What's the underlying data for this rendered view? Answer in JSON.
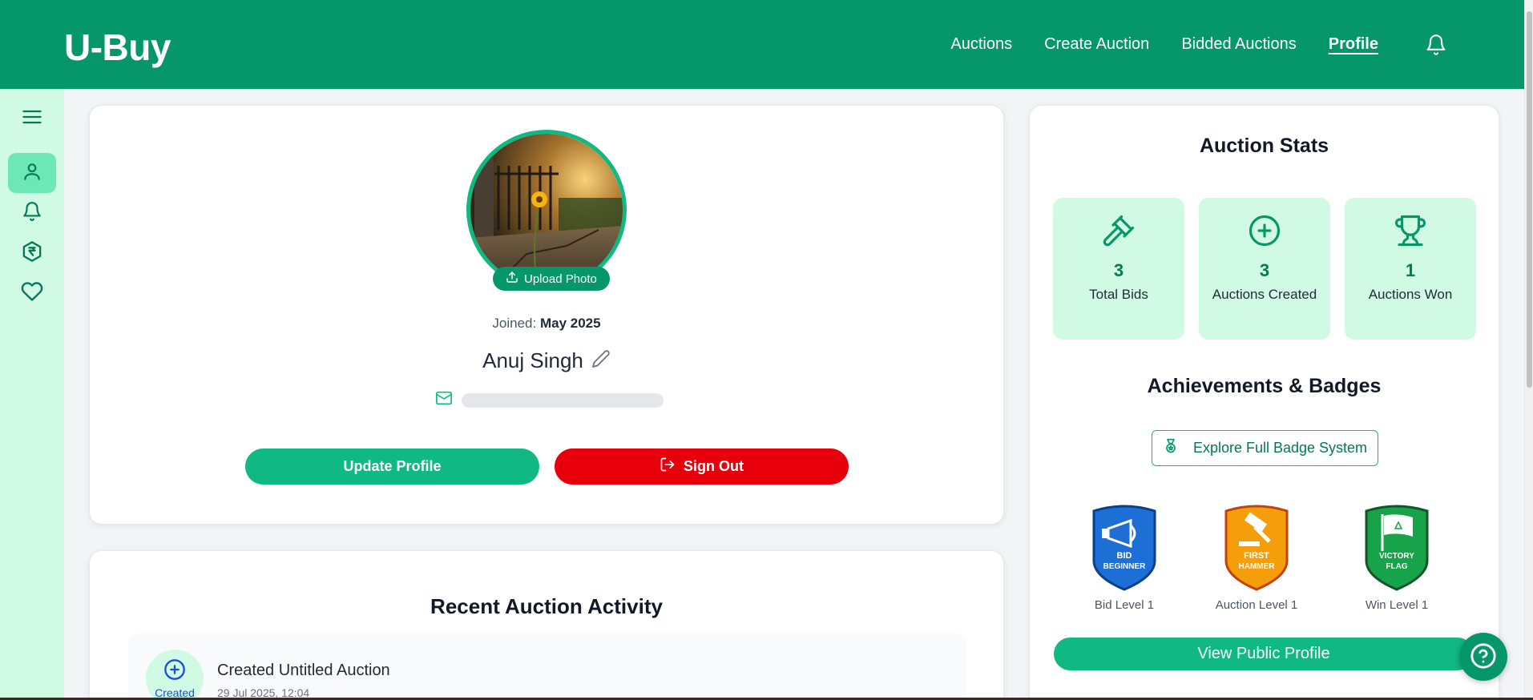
{
  "header": {
    "brand": "U-Buy",
    "nav": [
      {
        "label": "Auctions"
      },
      {
        "label": "Create Auction"
      },
      {
        "label": "Bidded Auctions"
      },
      {
        "label": "Profile",
        "active": true
      }
    ],
    "icons": {
      "notifications": "bell-icon"
    }
  },
  "sidebar": {
    "items": [
      {
        "icon": "menu-icon"
      },
      {
        "icon": "user-icon",
        "active": true
      },
      {
        "icon": "bell-icon"
      },
      {
        "icon": "rupee-coin-icon"
      },
      {
        "icon": "heart-icon"
      }
    ]
  },
  "profile": {
    "upload_label": "Upload Photo",
    "joined_label": "Joined:",
    "joined_value": "May 2025",
    "name": "Anuj Singh",
    "email": "",
    "update_label": "Update Profile",
    "signout_label": "Sign Out"
  },
  "activity": {
    "title": "Recent Auction Activity",
    "items": [
      {
        "icon_label": "Created",
        "name": "Created Untitled Auction",
        "time": "29 Jul 2025, 12:04"
      }
    ]
  },
  "stats": {
    "title": "Auction Stats",
    "boxes": [
      {
        "value": "3",
        "label": "Total Bids",
        "icon": "gavel-icon"
      },
      {
        "value": "3",
        "label": "Auctions Created",
        "icon": "plus-circle-icon"
      },
      {
        "value": "1",
        "label": "Auctions Won",
        "icon": "trophy-icon"
      }
    ]
  },
  "achievements": {
    "title": "Achievements & Badges",
    "explore_label": "Explore Full Badge System",
    "badges": [
      {
        "text_line1": "BID",
        "text_line2": "BEGINNER",
        "label": "Bid Level 1",
        "color": "#1d6fd6"
      },
      {
        "text_line1": "FIRST",
        "text_line2": "HAMMER",
        "label": "Auction Level 1",
        "color": "#f59e0b"
      },
      {
        "text_line1": "VICTORY",
        "text_line2": "FLAG",
        "label": "Win Level 1",
        "color": "#16a34a"
      }
    ],
    "public_profile_label": "View Public Profile"
  },
  "colors": {
    "primary": "#059669",
    "accent": "#10b981",
    "danger": "#e7000b",
    "light": "#d1fae5"
  }
}
